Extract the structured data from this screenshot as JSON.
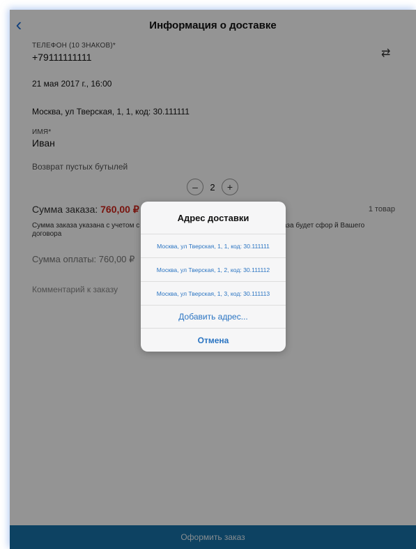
{
  "header": {
    "title": "Информация о доставке"
  },
  "phone": {
    "label": "ТЕЛЕФОН (10 ЗНАКОВ)*",
    "value": "+79111111111"
  },
  "delivery_time": "21 мая 2017 г., 16:00",
  "address": "Москва, ул Тверская, 1, 1, код: 30.111111",
  "name": {
    "label": "ИМЯ*",
    "value": "Иван"
  },
  "bottle_return": {
    "label": "Возврат пустых бутылей",
    "minus": "–",
    "value": "2",
    "plus": "+"
  },
  "order_sum": {
    "label": "Сумма заказа:",
    "amount": "760,00 ₽",
    "items_count": "1 товар"
  },
  "note": "Сумма заказа указана с учетом с                                        ии ООО «Эден Спрингс». Точная сумма заказа будет сфор                                        й Вашего договора",
  "payment_sum": "Сумма оплаты: 760,00 ₽",
  "comment_placeholder": "Комментарий к заказу",
  "checkout_label": "Оформить заказ",
  "sheet": {
    "title": "Адрес доставки",
    "options": [
      "Москва, ул Тверская, 1, 1, код: 30.111111",
      "Москва, ул Тверская, 1, 2, код: 30.111112",
      "Москва, ул Тверская, 1, 3, код: 30.111113"
    ],
    "add_label": "Добавить адрес...",
    "cancel_label": "Отмена"
  },
  "icons": {
    "back": "chevron-left-icon",
    "swap": "swap-arrows-icon"
  },
  "colors": {
    "accent": "#1f6fd6",
    "price": "#d0251b",
    "checkout_bar": "#1873aa"
  }
}
